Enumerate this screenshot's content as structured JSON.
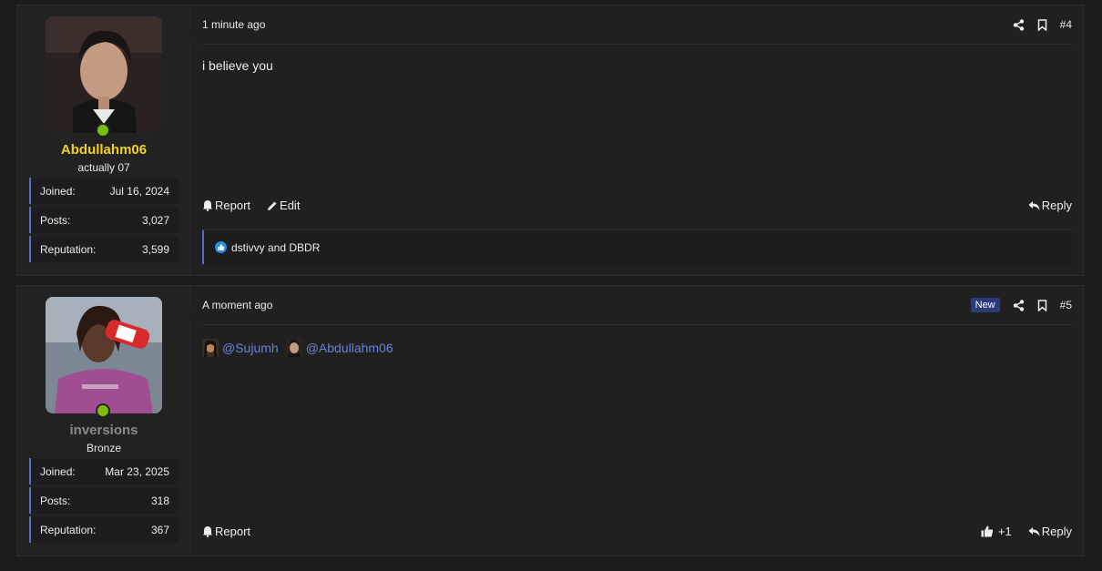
{
  "posts": [
    {
      "user": {
        "name": "Abdullahm06",
        "name_color": "#f2d21c",
        "title": "actually 07",
        "online": true,
        "stats": [
          {
            "label": "Joined:",
            "value": "Jul 16, 2024"
          },
          {
            "label": "Posts:",
            "value": "3,027"
          },
          {
            "label": "Reputation:",
            "value": "3,599"
          }
        ]
      },
      "time": "1 minute ago",
      "post_number": "#4",
      "body": "i believe you",
      "actions_left": [
        {
          "label": "Report",
          "icon": "bell-icon"
        },
        {
          "label": "Edit",
          "icon": "pencil-icon"
        }
      ],
      "reply_label": "Reply",
      "reactions_text": "dstivvy and DBDR"
    },
    {
      "user": {
        "name": "inversions",
        "name_color": "#8a8a8a",
        "title": "Bronze",
        "online": true,
        "stats": [
          {
            "label": "Joined:",
            "value": "Mar 23, 2025"
          },
          {
            "label": "Posts:",
            "value": "318"
          },
          {
            "label": "Reputation:",
            "value": "367"
          }
        ]
      },
      "time": "A moment ago",
      "new_badge": "New",
      "post_number": "#5",
      "mentions": [
        "@Sujumh",
        "@Abdullahm06"
      ],
      "actions_left": [
        {
          "label": "Report",
          "icon": "bell-icon"
        }
      ],
      "like_count": "+1",
      "reply_label": "Reply"
    }
  ]
}
